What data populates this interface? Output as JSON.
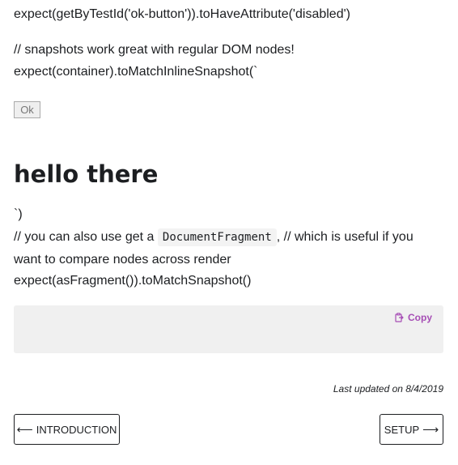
{
  "doc": {
    "line_disabled": "expect(getByTestId('ok-button')).toHaveAttribute('disabled')",
    "line_snapshots_comment": "// snapshots work great with regular DOM nodes!",
    "line_inline_snapshot": "expect(container).toMatchInlineSnapshot(`",
    "ok_button_label": "Ok",
    "heading": "hello there",
    "line_backtick_close": "`)",
    "line_fragment_before": "// you can also use get a ",
    "line_fragment_code": "DocumentFragment",
    "line_fragment_after": ", // which is useful if you want to compare nodes across render",
    "line_fragment_snapshot": "expect(asFragment()).toMatchSnapshot()"
  },
  "code_block": {
    "copy_label": "Copy",
    "copy_icon": "clipboard-icon"
  },
  "footer": {
    "last_updated": "Last updated on 8/4/2019"
  },
  "pagination": {
    "prev_label": "Introduction",
    "prev_icon": "arrow-left-icon",
    "next_label": "Setup",
    "next_icon": "arrow-right-icon"
  },
  "colors": {
    "accent": "#a64eb5",
    "text": "#1c1e21",
    "code_bg": "#f0f0f0"
  }
}
